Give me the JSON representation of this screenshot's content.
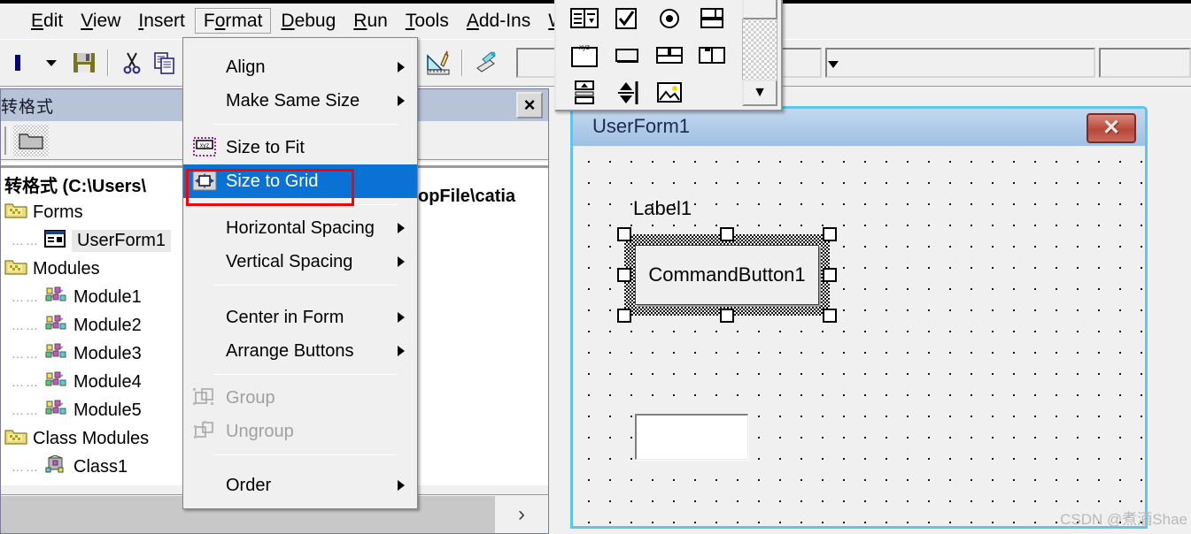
{
  "app": {
    "menubar": {
      "items": [
        {
          "label": "Edit",
          "accel": "E"
        },
        {
          "label": "View",
          "accel": "V"
        },
        {
          "label": "Insert",
          "accel": "I"
        },
        {
          "label": "Format",
          "accel": "o",
          "active": true
        },
        {
          "label": "Debug",
          "accel": "D"
        },
        {
          "label": "Run",
          "accel": "R"
        },
        {
          "label": "Tools",
          "accel": "T"
        },
        {
          "label": "Add-Ins",
          "accel": "A"
        },
        {
          "label": "W",
          "accel": "W"
        }
      ]
    },
    "toolbar": {
      "icons": [
        "dropdown-arrow-icon",
        "save-icon",
        "cut-icon",
        "copy-icon",
        "paste-icon",
        "color-swatch-icon",
        "ruler-pencil-icon",
        "object-browser-icon"
      ],
      "combo_value": "",
      "combo2_value": ""
    }
  },
  "project_window": {
    "title": "转格式",
    "close_label": "×",
    "toolbar_icon": "folder-icon",
    "root_label": "转格式 (C:\\Users\\",
    "root_label_tail": "opFile\\catia",
    "tree": [
      {
        "label": "Forms",
        "icon": "folder-forms-icon",
        "depth": 0,
        "selected": false
      },
      {
        "label": "UserForm1",
        "icon": "userform-icon",
        "depth": 1,
        "selected": true
      },
      {
        "label": "Modules",
        "icon": "folder-modules-icon",
        "depth": 0,
        "selected": false
      },
      {
        "label": "Module1",
        "icon": "module-icon",
        "depth": 1,
        "selected": false
      },
      {
        "label": "Module2",
        "icon": "module-icon",
        "depth": 1,
        "selected": false
      },
      {
        "label": "Module3",
        "icon": "module-icon",
        "depth": 1,
        "selected": false
      },
      {
        "label": "Module4",
        "icon": "module-icon",
        "depth": 1,
        "selected": false
      },
      {
        "label": "Module5",
        "icon": "module-icon",
        "depth": 1,
        "selected": false
      },
      {
        "label": "Class Modules",
        "icon": "folder-class-icon",
        "depth": 0,
        "selected": false
      },
      {
        "label": "Class1",
        "icon": "class-icon",
        "depth": 1,
        "selected": false
      }
    ],
    "hscroll_right_glyph": "›"
  },
  "format_menu": {
    "items": [
      {
        "label": "Align",
        "accel": "A",
        "submenu": true,
        "icon": null,
        "state": "normal"
      },
      {
        "label": "Make Same Size",
        "accel": "M",
        "submenu": true,
        "icon": null,
        "state": "normal"
      },
      {
        "separator": true
      },
      {
        "label": "Size to Fit",
        "accel": "t",
        "submenu": false,
        "icon": "size-to-fit-icon",
        "state": "normal"
      },
      {
        "label": "Size to Grid",
        "accel": "d",
        "submenu": false,
        "icon": "size-to-grid-icon",
        "state": "highlighted"
      },
      {
        "separator": true
      },
      {
        "label": "Horizontal Spacing",
        "accel": "H",
        "submenu": true,
        "icon": null,
        "state": "normal"
      },
      {
        "label": "Vertical Spacing",
        "accel": "V",
        "submenu": true,
        "icon": null,
        "state": "normal"
      },
      {
        "separator": true
      },
      {
        "label": "Center in Form",
        "accel": "C",
        "submenu": true,
        "icon": null,
        "state": "normal"
      },
      {
        "label": "Arrange Buttons",
        "accel": "r",
        "submenu": true,
        "icon": null,
        "state": "normal"
      },
      {
        "separator": true
      },
      {
        "label": "Group",
        "accel": "G",
        "submenu": false,
        "icon": "group-icon",
        "state": "disabled"
      },
      {
        "label": "Ungroup",
        "accel": "U",
        "submenu": false,
        "icon": "ungroup-icon",
        "state": "disabled"
      },
      {
        "separator": true
      },
      {
        "label": "Order",
        "accel": "O",
        "submenu": true,
        "icon": null,
        "state": "normal"
      }
    ],
    "highlight_color": "#0a72d4",
    "annotation_color": "#ff0000"
  },
  "toolbox": {
    "icons": [
      "listbox-icon",
      "checkbox-icon",
      "optionbutton-icon",
      "togglebutton-icon",
      "frame-icon",
      "commandbutton-icon",
      "tabstrip-icon",
      "multipage-icon",
      "scrollbar-icon",
      "spinbutton-icon",
      "image-icon",
      ""
    ],
    "scroll_down_glyph": "▼"
  },
  "userform": {
    "title": "UserForm1",
    "close_label": "✕",
    "border_color": "#5fc6e8",
    "controls": [
      {
        "type": "label",
        "name": "Label1",
        "caption": "Label1",
        "selected": false
      },
      {
        "type": "commandbutton",
        "name": "CommandButton1",
        "caption": "CommandButton1",
        "selected": true
      },
      {
        "type": "textbox",
        "name": "TextBox1",
        "caption": "",
        "selected": false
      }
    ]
  },
  "watermark": {
    "text": "CSDN @煮酒Shae"
  }
}
